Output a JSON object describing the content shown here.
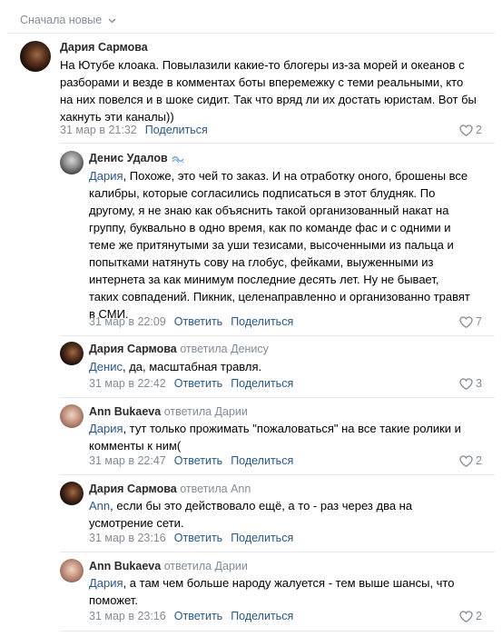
{
  "sort": {
    "label": "Сначала новые"
  },
  "comments": [
    {
      "author": "Дария Сармова",
      "text": "На Ютубе клоака. Повылазили какие-то блогеры из-за морей и океанов с разборами и везде в комментах боты вперемежку с теми реальными, кто на них повелся и в шоке сидит. Так что вряд ли их достать юристам. Вот бы хакнуть эти каналы))",
      "date": "31 мар в 21:32",
      "share": "Поделиться",
      "likes": "2"
    },
    {
      "author": "Денис Удалов",
      "mention": "Дария",
      "text": ", Похоже, это чей то заказ. И на отработку оного, брошены все калибры, которые согласились подписаться в этот блудняк. По другому, я не знаю как объяснить такой организованный накат на группу, буквально в одно время, как по команде фас и с одними и теме же притянутыми за уши тезисами, высоченными из пальца и попытками натянуть сову на глобус, фейками, выуженными из интернета за как минимум последние десять лет. Ну не бывает, таких совпадений. Пикник, целенаправленно и организованно травят в СМИ.",
      "date": "31 мар в 22:09",
      "reply": "Ответить",
      "share": "Поделиться",
      "likes": "7"
    },
    {
      "author": "Дария Сармова",
      "replied_to": "ответила Денису",
      "mention": "Денис",
      "text": ", да, масштабная травля.",
      "date": "31 мар в 22:42",
      "reply": "Ответить",
      "share": "Поделиться",
      "likes": "3"
    },
    {
      "author": "Ann Bukaeva",
      "replied_to": "ответила Дарии",
      "mention": "Дария",
      "text": ", тут только прожимать \"пожаловаться\" на все такие ролики и комменты к ним(",
      "date": "31 мар в 22:47",
      "reply": "Ответить",
      "share": "Поделиться",
      "likes": "2"
    },
    {
      "author": "Дария Сармова",
      "replied_to": "ответила Ann",
      "mention": "Ann",
      "text": ", если бы это действовало ещё, а то - раз через два на усмотрение сети.",
      "date": "31 мар в 23:16",
      "reply": "Ответить",
      "share": "Поделиться",
      "likes": ""
    },
    {
      "author": "Ann Bukaeva",
      "replied_to": "ответила Дарии",
      "mention": "Дария",
      "text": ", а там чем больше народу жалуется - тем выше шансы, что поможет.",
      "date": "31 мар в 23:16",
      "reply": "Ответить",
      "share": "Поделиться",
      "likes": "2"
    }
  ],
  "icons": {
    "like": "heart-icon",
    "verified": "verified-icon",
    "sort": "chevron-down-icon"
  },
  "colors": {
    "link": "#2a5885",
    "muted": "#818c99",
    "divider": "#e7e8ec"
  }
}
